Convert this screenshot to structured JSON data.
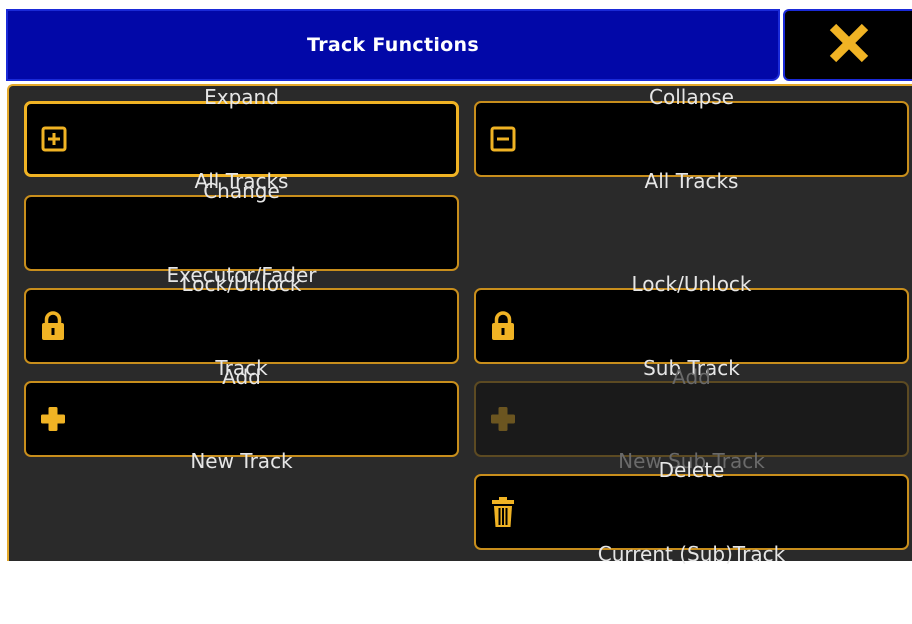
{
  "dialog": {
    "title": "Track Functions",
    "close_icon": "close-x-icon"
  },
  "colors": {
    "title_bar": "#0208a8",
    "accent": "#f0b324",
    "button_bg": "#000000",
    "panel_bg": "#2a2a2a",
    "text": "#e6e6e6",
    "disabled_text": "#6a6a6a"
  },
  "buttons": {
    "expand": {
      "line1": "Expand",
      "line2": "All Tracks",
      "icon": "plus-box-icon"
    },
    "collapse": {
      "line1": "Collapse",
      "line2": "All Tracks",
      "icon": "minus-box-icon"
    },
    "change": {
      "line1": "Change",
      "line2": "Executor/Fader"
    },
    "lock_track": {
      "line1": "Lock/Unlock",
      "line2": "Track",
      "icon": "lock-icon"
    },
    "lock_sub": {
      "line1": "Lock/Unlock",
      "line2": "Sub Track",
      "icon": "lock-icon"
    },
    "add_track": {
      "line1": "Add",
      "line2": "New Track",
      "icon": "plus-icon"
    },
    "add_sub": {
      "line1": "Add",
      "line2": "New Sub Track",
      "icon": "plus-icon",
      "disabled": true
    },
    "delete": {
      "line1": "Delete",
      "line2": "Current (Sub)Track",
      "icon": "trash-icon"
    }
  }
}
